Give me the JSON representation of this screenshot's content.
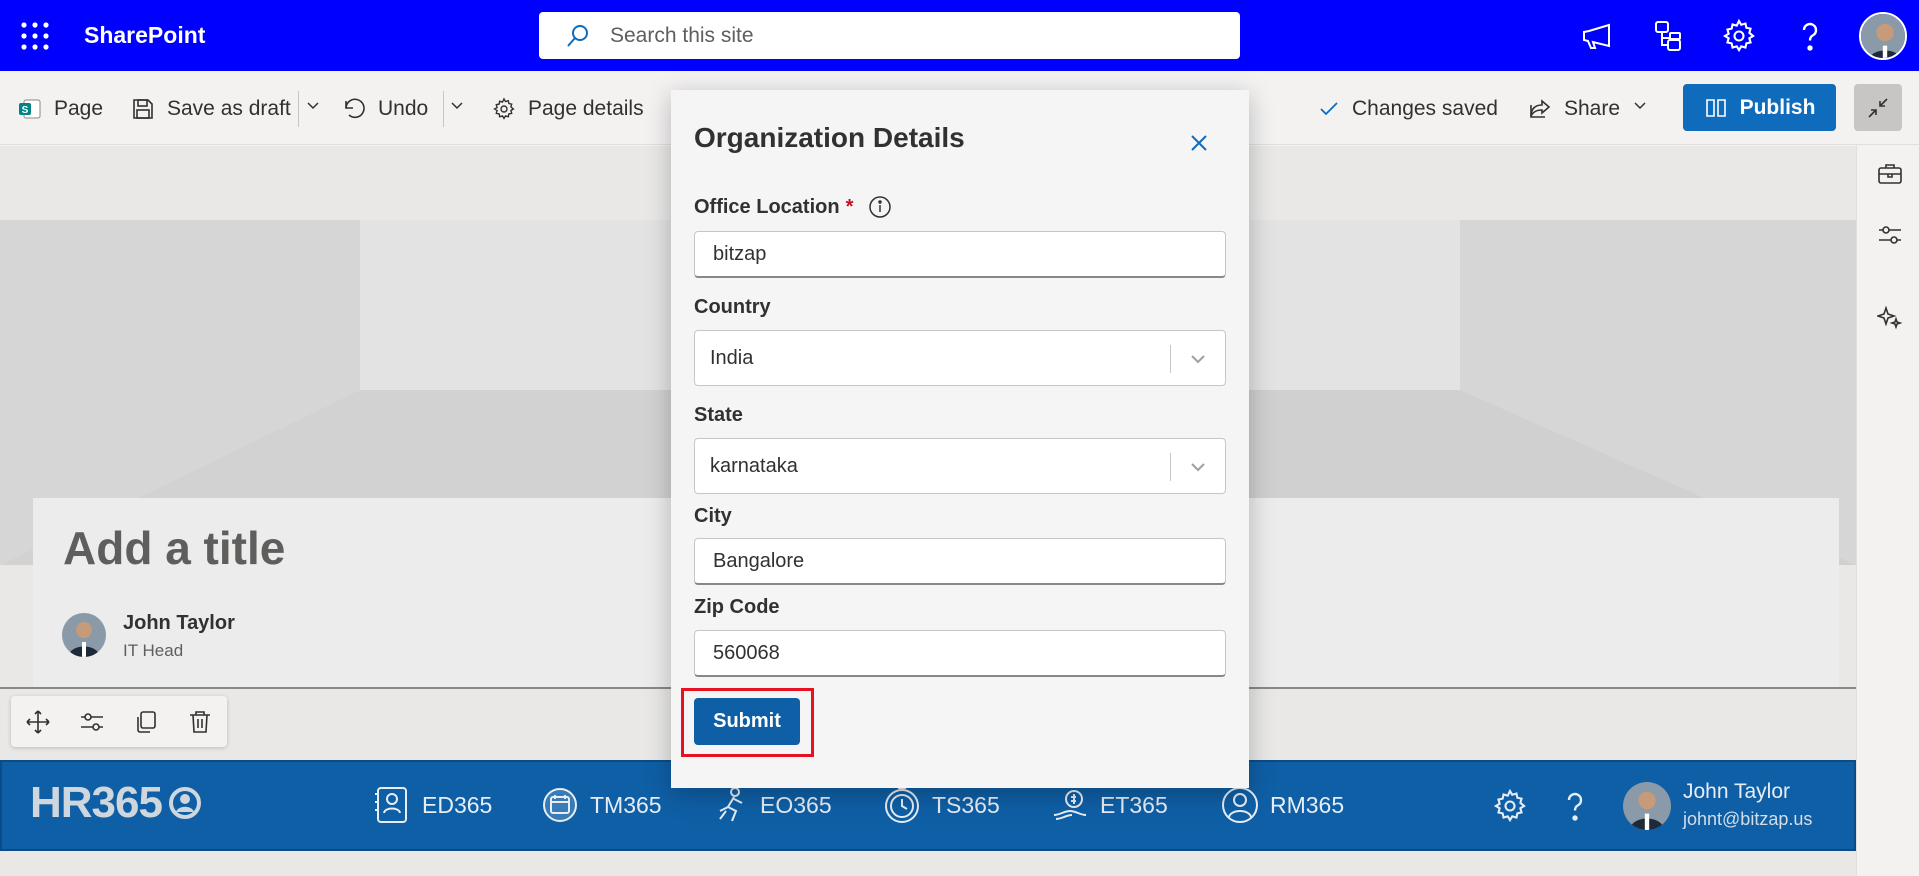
{
  "suite": {
    "app_name": "SharePoint",
    "search_placeholder": "Search this site"
  },
  "command_bar": {
    "page_label": "Page",
    "save_draft_label": "Save as draft",
    "undo_label": "Undo",
    "page_details_label": "Page details",
    "status_label": "Changes saved",
    "share_label": "Share",
    "publish_label": "Publish"
  },
  "page": {
    "title_placeholder": "Add a title",
    "author_name": "John Taylor",
    "author_role": "IT Head"
  },
  "dialog": {
    "title": "Organization Details",
    "fields": {
      "office_location": {
        "label": "Office Location",
        "required_mark": "*",
        "value": "bitzap"
      },
      "country": {
        "label": "Country",
        "value": "India"
      },
      "state": {
        "label": "State",
        "value": "karnataka"
      },
      "city": {
        "label": "City",
        "value": "Bangalore"
      },
      "zip": {
        "label": "Zip Code",
        "value": "560068"
      }
    },
    "submit_label": "Submit"
  },
  "hr_bar": {
    "logo_text": "HR365",
    "apps": [
      "ED365",
      "TM365",
      "EO365",
      "TS365",
      "ET365",
      "RM365"
    ],
    "user_name": "John Taylor",
    "user_email": "johnt@bitzap.us"
  },
  "colors": {
    "suite_bar": "#0000ff",
    "accent": "#0f6cbd",
    "hr_bar": "#0f5fa6",
    "highlight": "#e81123",
    "required": "#c50f1f"
  }
}
